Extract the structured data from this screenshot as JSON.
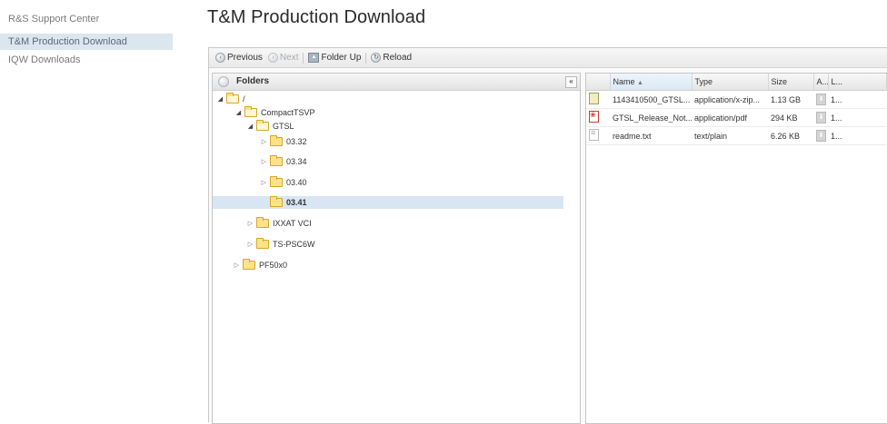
{
  "nav": {
    "items": [
      {
        "label": "R&S Support Center"
      },
      {
        "label": "T&M Production Download"
      },
      {
        "label": "IQW Downloads"
      }
    ]
  },
  "page": {
    "title": "T&M Production Download"
  },
  "toolbar": {
    "previous": "Previous",
    "next": "Next",
    "folder_up": "Folder Up",
    "reload": "Reload"
  },
  "folders": {
    "title": "Folders",
    "collapse_symbol": "«",
    "tree": [
      {
        "label": "/"
      },
      {
        "label": "CompactTSVP"
      },
      {
        "label": "GTSL"
      },
      {
        "label": "03.32"
      },
      {
        "label": "03.34"
      },
      {
        "label": "03.40"
      },
      {
        "label": "03.41",
        "selected": true
      },
      {
        "label": "IXXAT VCI"
      },
      {
        "label": "TS-PSC6W"
      },
      {
        "label": "PF50x0"
      }
    ]
  },
  "files": {
    "columns": {
      "name": "Name",
      "type": "Type",
      "size": "Size",
      "a": "A...",
      "l": "L..."
    },
    "rows": [
      {
        "name": "1143410500_GTSL...",
        "type": "application/x-zip...",
        "size": "1.13 GB",
        "last": "1...",
        "icon": "zip-file-icon"
      },
      {
        "name": "GTSL_Release_Not...",
        "type": "application/pdf",
        "size": "294 KB",
        "last": "1...",
        "icon": "pdf-file-icon"
      },
      {
        "name": "readme.txt",
        "type": "text/plain",
        "size": "6.26 KB",
        "last": "1...",
        "icon": "text-file-icon"
      }
    ]
  },
  "colors": {
    "selected": "#d8e6f4",
    "nav_active": "#dce6ef",
    "folder": "#fde28a"
  }
}
